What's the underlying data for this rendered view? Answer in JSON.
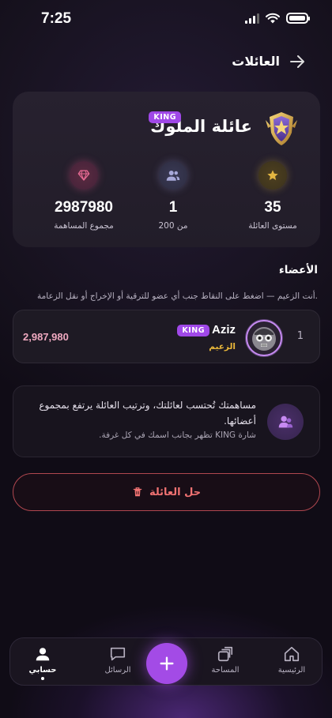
{
  "status_bar": {
    "time": "7:25"
  },
  "header": {
    "title": "العائلات"
  },
  "family": {
    "name": "عائلة الملوك",
    "badge": "KING",
    "stats": {
      "level": {
        "value": "35",
        "label": "مستوى العائلة",
        "icon": "star-icon",
        "color": "#e3b641"
      },
      "members": {
        "value": "1",
        "label": "من 200",
        "icon": "people-icon",
        "color": "#a7a8d8"
      },
      "contribution": {
        "value": "2987980",
        "label": "مجموع المساهمة",
        "icon": "gem-icon",
        "color": "#e86b95"
      }
    }
  },
  "members_section": {
    "title": "الأعضاء",
    "hint": "أنت الزعيم — اضغط على النقاط جنب أي عضو للترقية أو الإخراج أو نقل الزعامة.",
    "members": [
      {
        "rank": "1",
        "name": "Aziz",
        "badge": "KING",
        "role": "الزعيم",
        "score": "2,987,980"
      }
    ]
  },
  "info": {
    "main": "مساهمتك تُحتسب لعائلتك، وترتيب العائلة يرتفع بمجموع أعضائها.",
    "sub": "شارة KING تظهر بجانب اسمك في كل غرفة."
  },
  "dissolve": {
    "label": "حل العائلة"
  },
  "nav": {
    "home": "الرئيسية",
    "space": "المساحة",
    "messages": "الرسائل",
    "profile": "حسابي"
  },
  "colors": {
    "accent": "#a34be6",
    "danger": "#f07272",
    "gold": "#e9b73a"
  }
}
